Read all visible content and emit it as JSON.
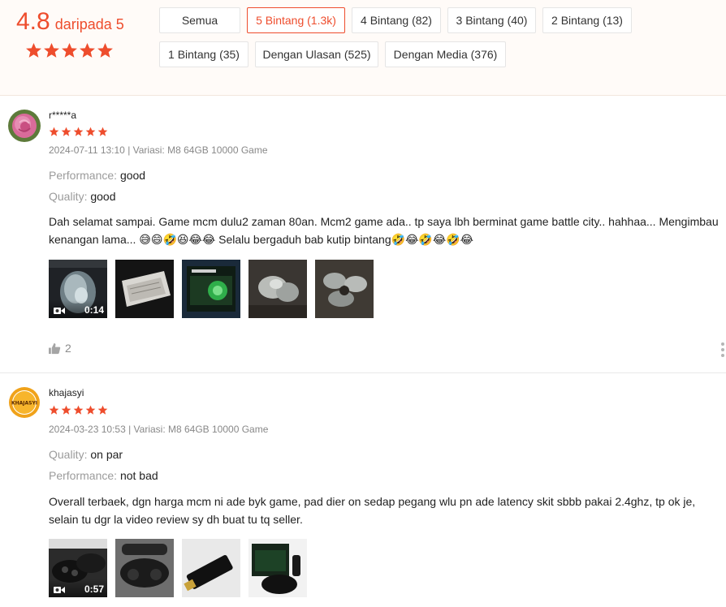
{
  "summary": {
    "score": "4.8",
    "out_of": "daripada 5",
    "stars": 5
  },
  "filters": [
    {
      "label": "Semua",
      "active": false
    },
    {
      "label": "5 Bintang (1.3k)",
      "active": true
    },
    {
      "label": "4 Bintang (82)",
      "active": false
    },
    {
      "label": "3 Bintang (40)",
      "active": false
    },
    {
      "label": "2 Bintang (13)",
      "active": false
    },
    {
      "label": "1 Bintang (35)",
      "active": false
    },
    {
      "label": "Dengan Ulasan (525)",
      "active": false
    },
    {
      "label": "Dengan Media (376)",
      "active": false
    }
  ],
  "reviews": [
    {
      "username": "r*****a",
      "rating": 5,
      "meta": "2024-07-11 13:10 | Variasi: M8 64GB 10000 Game",
      "attributes": [
        {
          "label": "Performance:",
          "value": "good"
        },
        {
          "label": "Quality:",
          "value": "good"
        }
      ],
      "comment": "Dah selamat sampai. Game mcm dulu2 zaman 80an. Mcm2 game ada.. tp saya lbh berminat game battle city.. hahhaa... Mengimbau kenangan lama... ",
      "comment_emojis_1": "😅😄🤣😆😂😂",
      "comment_tail": " Selalu bergaduh bab kutip bintang",
      "comment_emojis_2": "🤣😂🤣😂🤣😂",
      "video_duration": "0:14",
      "likes": "2"
    },
    {
      "username": "khajasyi",
      "avatar_text": "KHAJASYI",
      "rating": 5,
      "meta": "2024-03-23 10:53 | Variasi: M8 64GB 10000 Game",
      "attributes": [
        {
          "label": "Quality:",
          "value": "on par"
        },
        {
          "label": "Performance:",
          "value": "not bad"
        }
      ],
      "comment": "Overall terbaek, dgn harga mcm ni ade byk game, pad dier on sedap pegang wlu pn ade latency skit sbbb pakai 2.4ghz, tp ok je, selain tu dgr la video review sy dh buat tu tq seller.",
      "video_duration": "0:57"
    }
  ],
  "colors": {
    "accent": "#ee4d2d",
    "overview_bg": "#fffbf8",
    "muted_text": "#888888"
  },
  "icons": [
    "star-icon",
    "video-camera-icon",
    "thumbs-up-icon",
    "more-options-icon"
  ]
}
